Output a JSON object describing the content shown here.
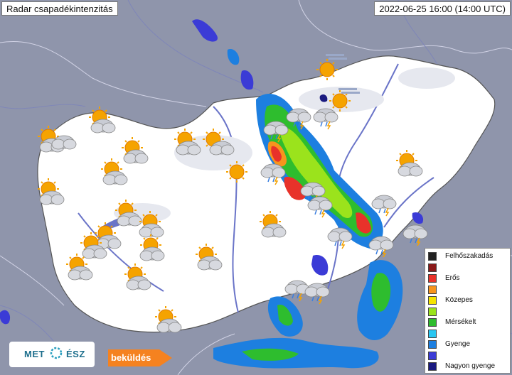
{
  "header": {
    "title": "Radar csapadékintenzitás",
    "timestamp": "2022-06-25 16:00 (14:00 UTC)"
  },
  "legend": {
    "items": [
      {
        "label": "Felhőszakadás",
        "color": "#222222"
      },
      {
        "label": "",
        "color": "#8b1a1a"
      },
      {
        "label": "Erős",
        "color": "#e8322a"
      },
      {
        "label": "",
        "color": "#f7941d"
      },
      {
        "label": "Közepes",
        "color": "#f5e400"
      },
      {
        "label": "",
        "color": "#9be31c"
      },
      {
        "label": "Mérsékelt",
        "color": "#2ebd2e"
      },
      {
        "label": "",
        "color": "#29c7f2"
      },
      {
        "label": "Gyenge",
        "color": "#1d7fe0"
      },
      {
        "label": "",
        "color": "#3b3bd6"
      },
      {
        "label": "Nagyon gyenge",
        "color": "#1a1a80"
      }
    ]
  },
  "logo": {
    "left_text": "MET",
    "right_text": "ÉSZ"
  },
  "send_button": {
    "label": "beküldés",
    "color": "#f58220"
  },
  "colors": {
    "land": "#ffffff",
    "outside": "#8f95ab",
    "rivers": "#6a74c8"
  }
}
